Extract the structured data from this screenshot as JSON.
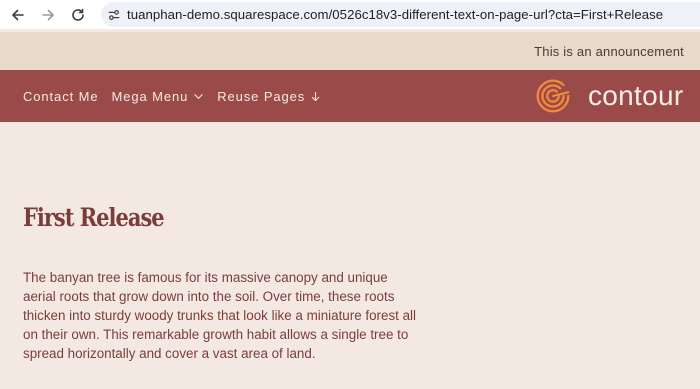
{
  "browser": {
    "url": "tuanphan-demo.squarespace.com/0526c18v3-different-text-on-page-url?cta=First+Release",
    "icons": [
      "arrow-left-icon",
      "arrow-right-icon",
      "reload-icon",
      "site-info-icon"
    ]
  },
  "announcement": {
    "text": "This is an announcement"
  },
  "header": {
    "nav_items": [
      {
        "label": "Contact Me"
      },
      {
        "label": "Mega Menu",
        "icon": "chevron-down-icon"
      },
      {
        "label": "Reuse Pages",
        "icon": "arrow-down-icon"
      }
    ],
    "logo_text": "contour"
  },
  "main": {
    "title": "First Release",
    "body": "The banyan tree is famous for its massive canopy and unique aerial roots that grow down into the soil. Over time, these roots thicken into sturdy woody trunks that look like a miniature forest all on their own. This remarkable growth habit allows a single tree to spread horizontally and cover a vast area of land."
  },
  "colors": {
    "page_background": "#f4e8e2",
    "announcement_background": "#e7dacb",
    "header_background": "#9a4a48",
    "text_accent": "#7a3e3a",
    "logo_orange": "#f08a3c"
  }
}
